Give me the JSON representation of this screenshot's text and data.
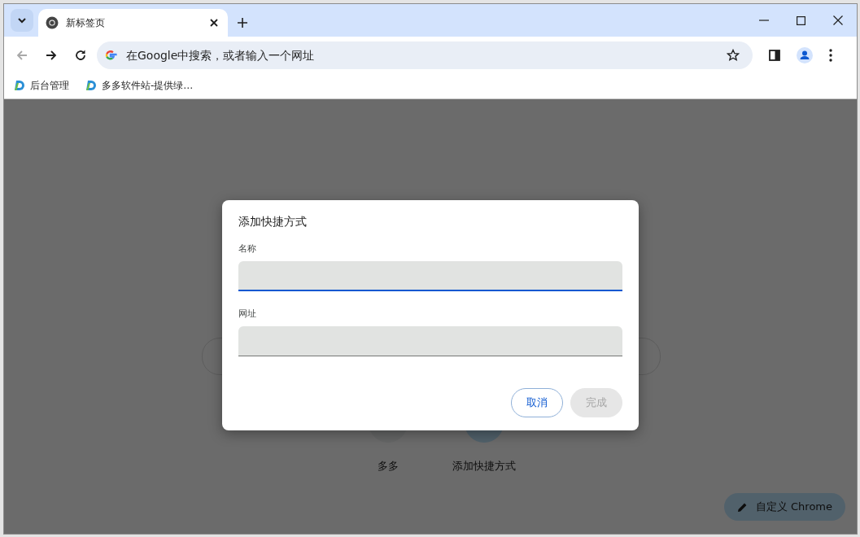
{
  "tabs": [
    {
      "title": "新标签页",
      "selected": true
    }
  ],
  "nav": [
    {
      "kind": "back",
      "disabled": true
    },
    {
      "kind": "forward",
      "disabled": false
    },
    {
      "kind": "reload",
      "disabled": false
    }
  ],
  "address_bar": {
    "placeholder": "在Google中搜索，或者输入一个网址",
    "starred": false
  },
  "bookmarks": [
    {
      "label": "后台管理"
    },
    {
      "label": "多多软件站-提供绿…"
    }
  ],
  "page": {
    "shortcuts": [
      {
        "label": "多多",
        "kind": "site"
      },
      {
        "label": "添加快捷方式",
        "kind": "add"
      }
    ],
    "customize_button": "自定义 Chrome"
  },
  "dialog": {
    "title": "添加快捷方式",
    "fields": [
      {
        "label": "名称",
        "focused": true
      },
      {
        "label": "网址",
        "focused": false
      }
    ],
    "buttons": [
      {
        "label": "取消",
        "disabled": false
      },
      {
        "label": "完成",
        "disabled": true
      }
    ]
  }
}
